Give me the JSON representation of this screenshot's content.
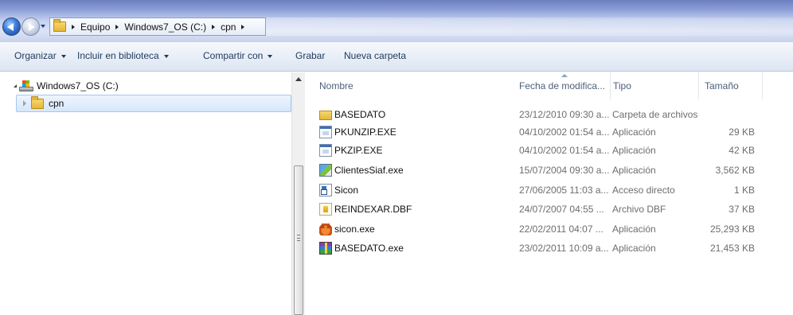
{
  "addressbar": {
    "crumbs": [
      "Equipo",
      "Windows7_OS (C:)",
      "cpn"
    ]
  },
  "toolbar": {
    "organize": "Organizar",
    "include_library": "Incluir en biblioteca",
    "share_with": "Compartir con",
    "burn": "Grabar",
    "new_folder": "Nueva carpeta"
  },
  "navpane": {
    "drive": "Windows7_OS (C:)",
    "selected_folder": "cpn"
  },
  "columns": {
    "name": "Nombre",
    "date": "Fecha de modifica...",
    "type": "Tipo",
    "size": "Tamaño"
  },
  "files": [
    {
      "name": "BASEDATO",
      "date": "23/12/2010 09:30 a...",
      "type": "Carpeta de archivos",
      "size": "",
      "icon": "folder-icon"
    },
    {
      "name": "PKUNZIP.EXE",
      "date": "04/10/2002 01:54 a...",
      "type": "Aplicación",
      "size": "29 KB",
      "icon": "exe-icon"
    },
    {
      "name": "PKZIP.EXE",
      "date": "04/10/2002 01:54 a...",
      "type": "Aplicación",
      "size": "42 KB",
      "icon": "exe-icon"
    },
    {
      "name": "ClientesSiaf.exe",
      "date": "15/07/2004 09:30 a...",
      "type": "Aplicación",
      "size": "3,562 KB",
      "icon": "setup-icon"
    },
    {
      "name": "Sicon",
      "date": "27/06/2005 11:03 a...",
      "type": "Acceso directo",
      "size": "1 KB",
      "icon": "shortcut-icon"
    },
    {
      "name": "REINDEXAR.DBF",
      "date": "24/07/2007 04:55 ...",
      "type": "Archivo DBF",
      "size": "37 KB",
      "icon": "dbf-icon"
    },
    {
      "name": "sicon.exe",
      "date": "22/02/2011 04:07 ...",
      "type": "Aplicación",
      "size": "25,293 KB",
      "icon": "foxpro-icon"
    },
    {
      "name": "BASEDATO.exe",
      "date": "23/02/2011 10:09 a...",
      "type": "Aplicación",
      "size": "21,453 KB",
      "icon": "winrar-icon"
    }
  ]
}
